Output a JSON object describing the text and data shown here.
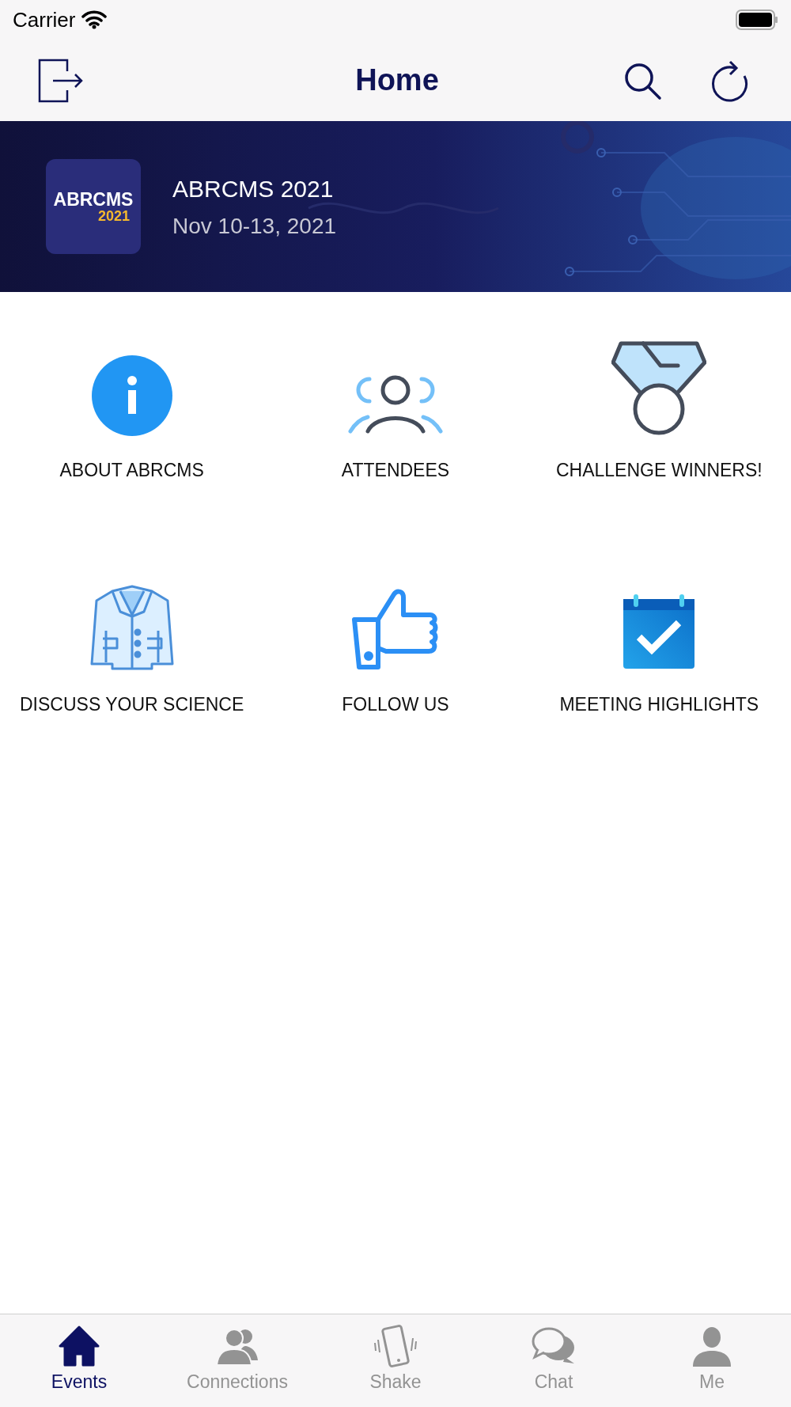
{
  "status_bar": {
    "carrier": "Carrier"
  },
  "nav_bar": {
    "title": "Home"
  },
  "banner": {
    "logo": {
      "line1": "ABRCMS",
      "line2": "2021"
    },
    "title": "ABRCMS 2021",
    "dates": "Nov 10-13, 2021"
  },
  "tiles": [
    {
      "kind": "info",
      "label": "ABOUT ABRCMS"
    },
    {
      "kind": "people",
      "label": "ATTENDEES"
    },
    {
      "kind": "medal",
      "label": "CHALLENGE WINNERS!"
    },
    {
      "kind": "coat",
      "label": "DISCUSS YOUR SCIENCE"
    },
    {
      "kind": "thumb",
      "label": "FOLLOW US"
    },
    {
      "kind": "calendar",
      "label": "MEETING HIGHLIGHTS"
    }
  ],
  "tab_bar": [
    {
      "kind": "home",
      "label": "Events",
      "selected": true
    },
    {
      "kind": "people",
      "label": "Connections",
      "selected": false
    },
    {
      "kind": "phone",
      "label": "Shake",
      "selected": false
    },
    {
      "kind": "chat",
      "label": "Chat",
      "selected": false
    },
    {
      "kind": "person",
      "label": "Me",
      "selected": false
    }
  ]
}
